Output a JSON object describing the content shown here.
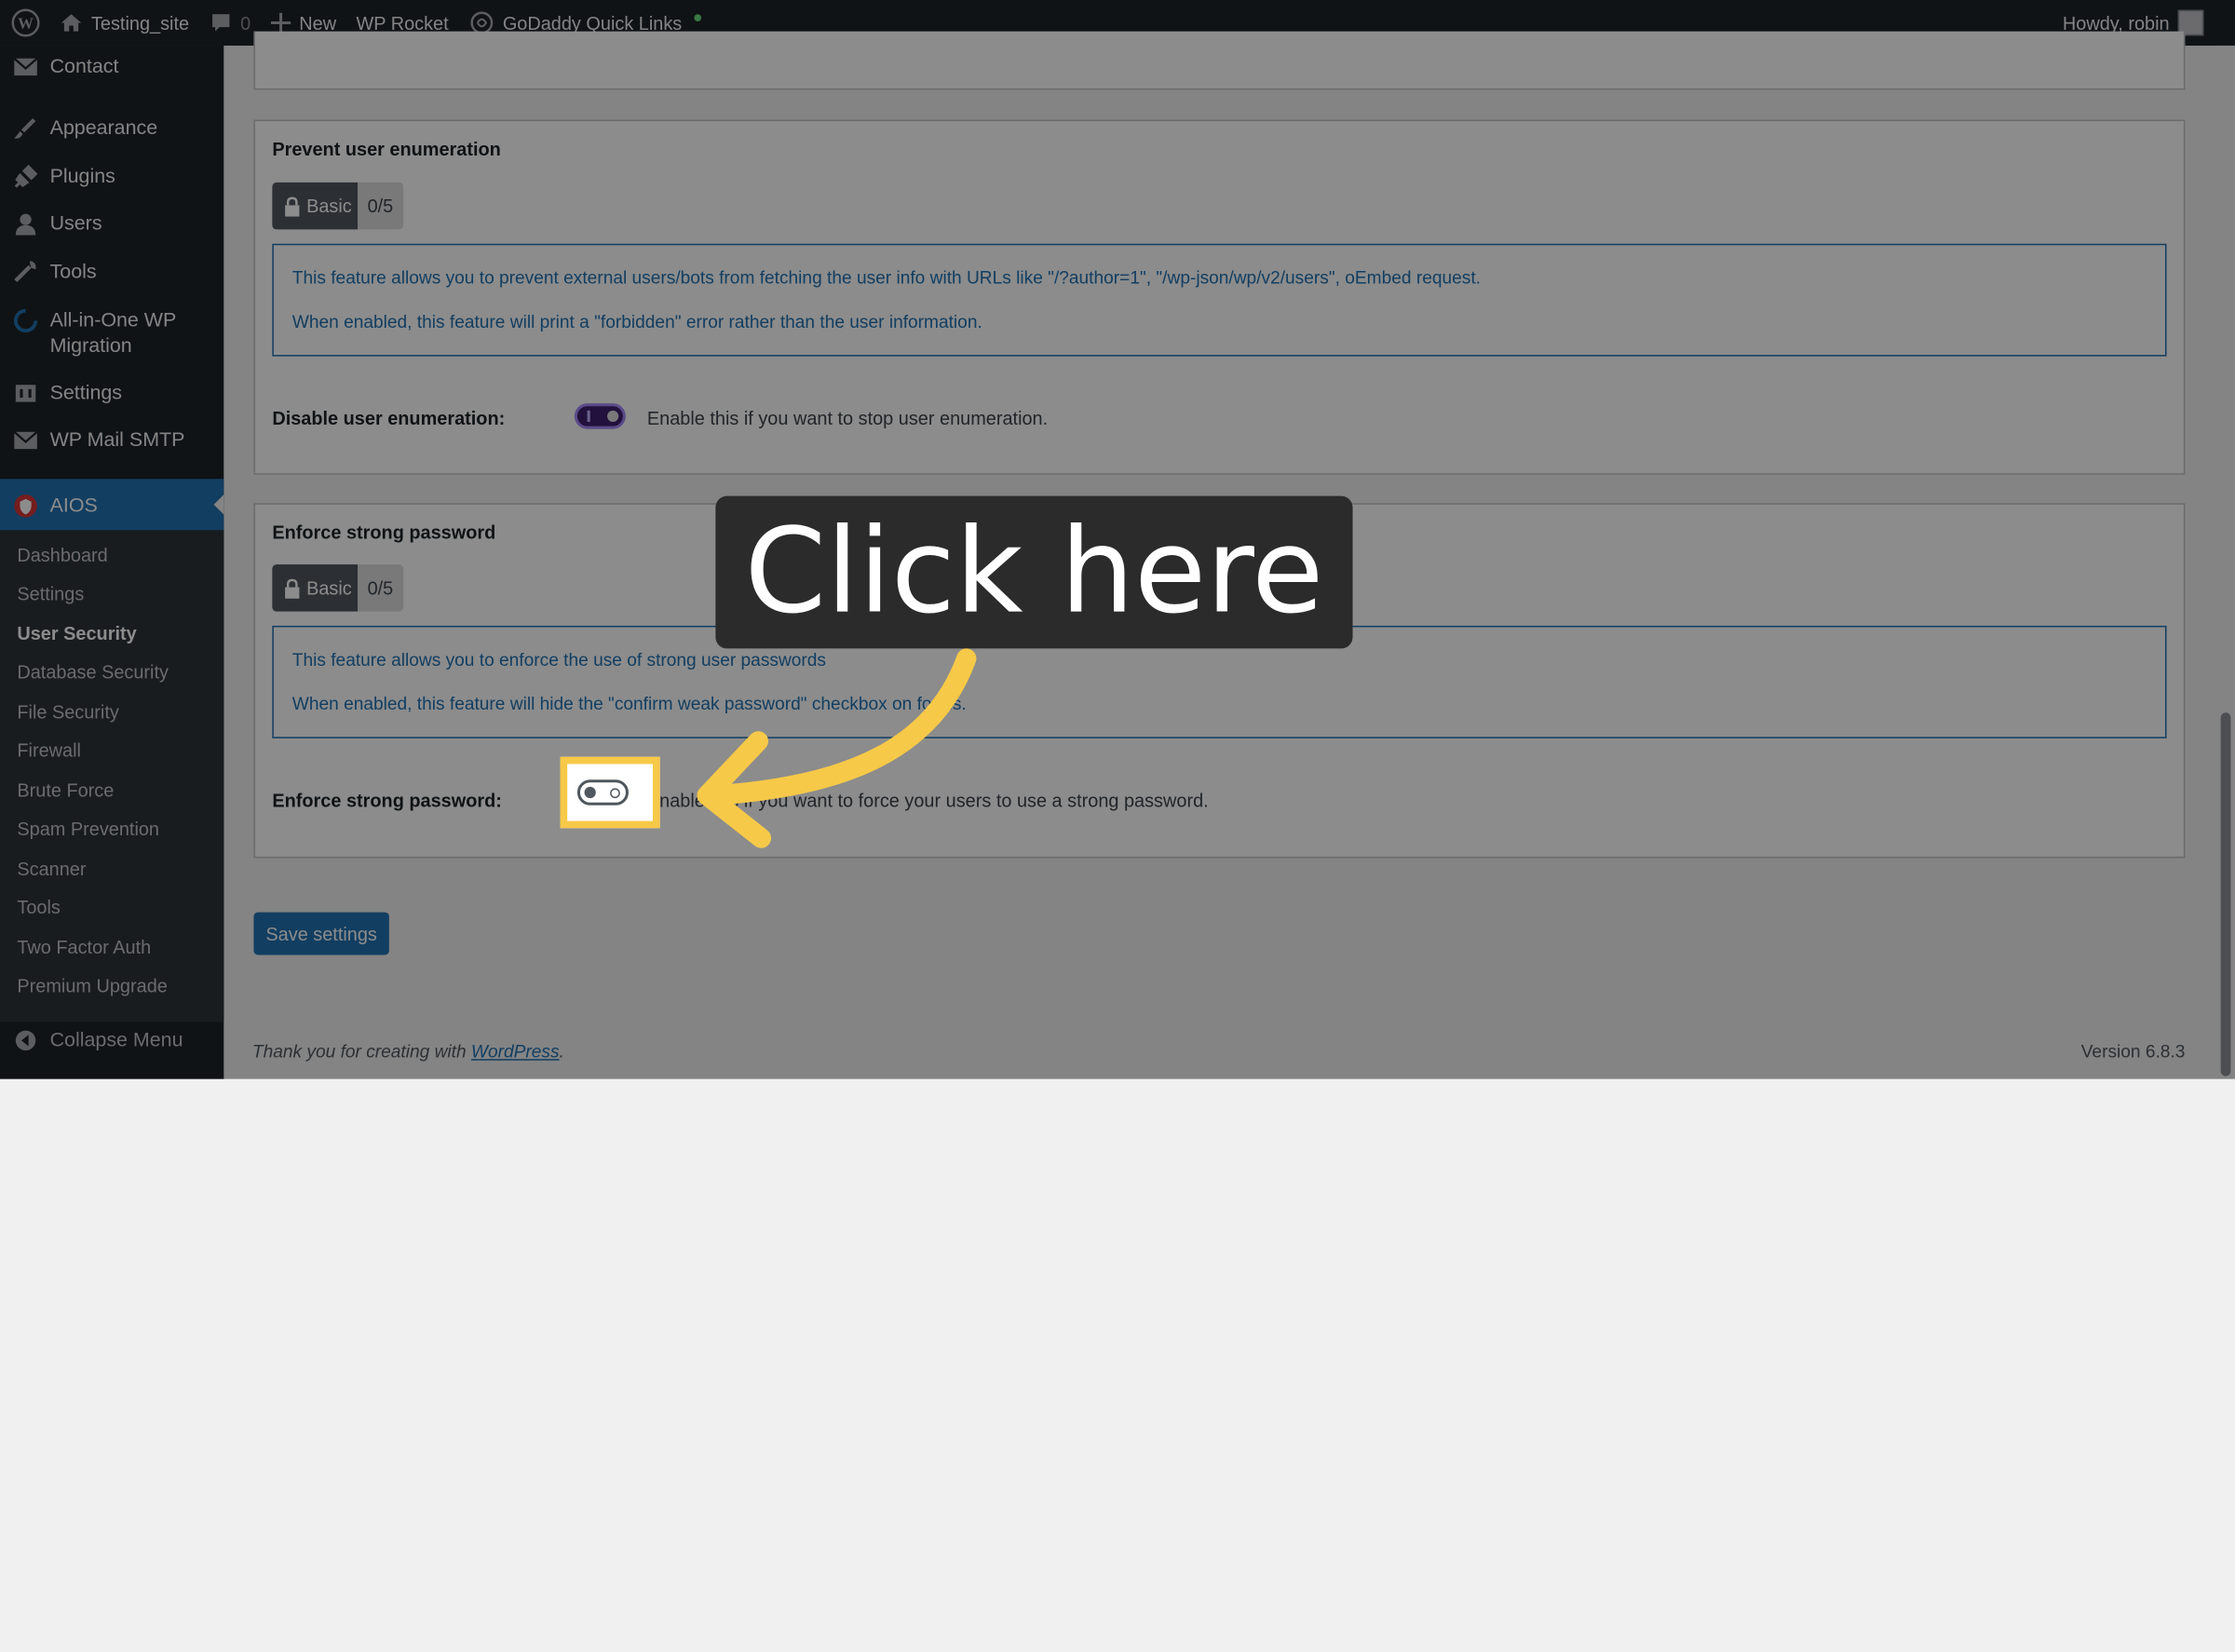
{
  "admin_bar": {
    "site_name": "Testing_site",
    "comments_count": "0",
    "new_label": "New",
    "wp_rocket": "WP Rocket",
    "godaddy": "GoDaddy Quick Links",
    "howdy": "Howdy, robin"
  },
  "sidebar": {
    "items": [
      {
        "label": "Contact",
        "icon": "mail-icon"
      },
      {
        "label": "Appearance",
        "icon": "brush-icon"
      },
      {
        "label": "Plugins",
        "icon": "plugin-icon"
      },
      {
        "label": "Users",
        "icon": "user-icon"
      },
      {
        "label": "Tools",
        "icon": "wrench-icon"
      },
      {
        "label": "All-in-One WP Migration",
        "icon": "migration-icon"
      },
      {
        "label": "Settings",
        "icon": "settings-icon"
      },
      {
        "label": "WP Mail SMTP",
        "icon": "mail-smtp-icon"
      }
    ],
    "current": "AIOS",
    "submenu": [
      "Dashboard",
      "Settings",
      "User Security",
      "Database Security",
      "File Security",
      "Firewall",
      "Brute Force",
      "Spam Prevention",
      "Scanner",
      "Tools",
      "Two Factor Auth",
      "Premium Upgrade"
    ],
    "submenu_active": "User Security",
    "collapse": "Collapse Menu"
  },
  "panel_enum": {
    "title": "Prevent user enumeration",
    "badge": "Basic",
    "score": "0/5",
    "info_1": "This feature allows you to prevent external users/bots from fetching the user info with URLs like \"/?author=1\", \"/wp-json/wp/v2/users\", oEmbed request.",
    "info_2": "When enabled, this feature will print a \"forbidden\" error rather than the user information.",
    "row_label": "Disable user enumeration:",
    "row_desc": "Enable this if you want to stop user enumeration.",
    "toggle_on": true
  },
  "panel_password": {
    "title": "Enforce strong password",
    "badge": "Basic",
    "score": "0/5",
    "info_1": "This feature allows you to enforce the use of strong user passwords",
    "info_2": "When enabled, this feature will hide the \"confirm weak password\" checkbox on forms.",
    "row_label": "Enforce strong password:",
    "row_desc": "Enable this if you want to force your users to use a strong password.",
    "toggle_on": false
  },
  "save_button": "Save settings",
  "footer": {
    "thanks_prefix": "Thank you for creating with ",
    "wordpress_link": "WordPress",
    "thanks_suffix": ".",
    "version": "Version 6.8.3"
  },
  "overlay": {
    "callout_text": "Click here",
    "accent_color": "#f7c948"
  }
}
